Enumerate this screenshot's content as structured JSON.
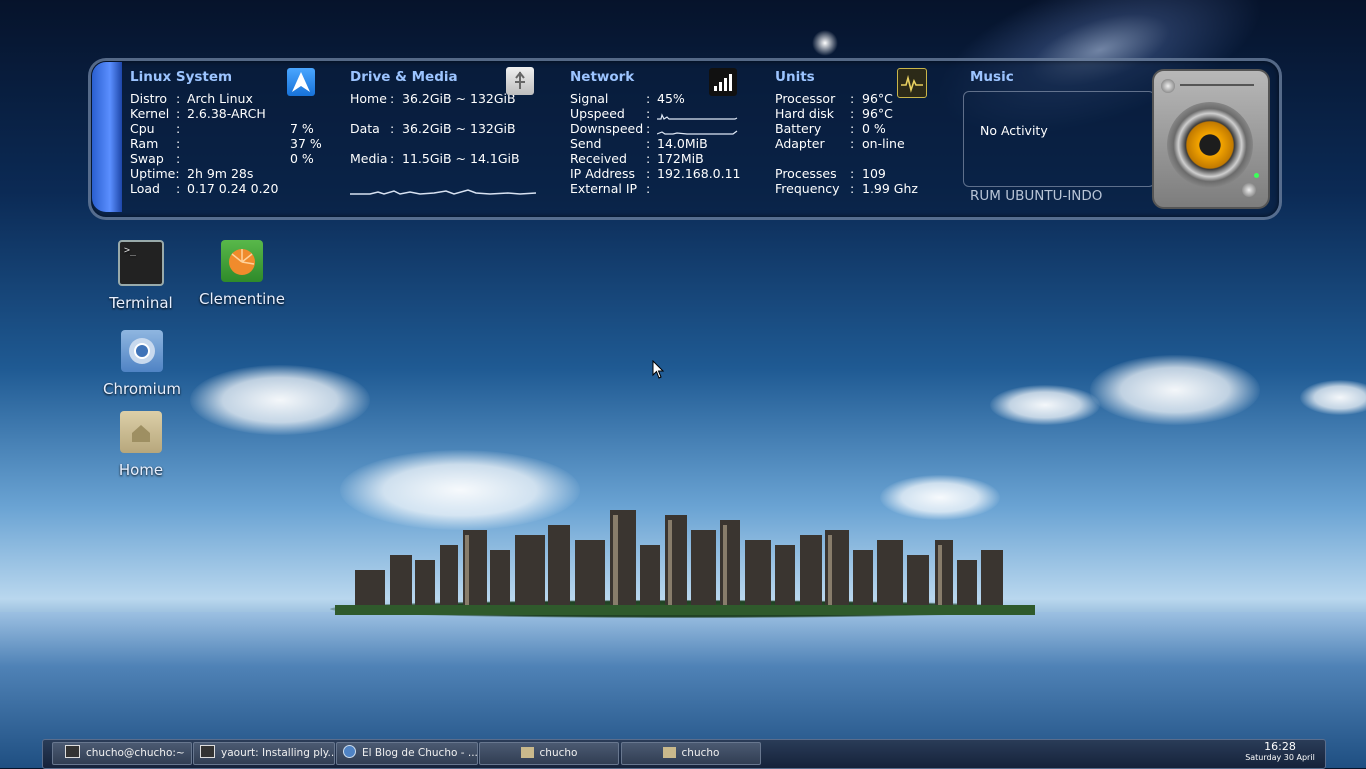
{
  "conky": {
    "linux": {
      "title": "Linux System",
      "rows": [
        {
          "k": "Distro",
          "v": "Arch Linux"
        },
        {
          "k": "Kernel",
          "v": "2.6.38-ARCH"
        },
        {
          "k": "Cpu",
          "v": "7 %"
        },
        {
          "k": "Ram",
          "v": "37 %"
        },
        {
          "k": "Swap",
          "v": "0 %"
        },
        {
          "k": "Uptime:",
          "v": "2h 9m 28s"
        },
        {
          "k": "Load",
          "v": "0.17 0.24 0.20"
        }
      ]
    },
    "drive": {
      "title": "Drive & Media",
      "rows": [
        {
          "k": "Home",
          "v": "36.2GiB ~ 132GiB"
        },
        {
          "k": "Data",
          "v": "36.2GiB ~ 132GiB"
        },
        {
          "k": "Media",
          "v": "11.5GiB ~ 14.1GiB"
        }
      ]
    },
    "network": {
      "title": "Network",
      "rows": [
        {
          "k": "Signal",
          "v": "45%"
        },
        {
          "k": "Upspeed",
          "v": ""
        },
        {
          "k": "Downspeed",
          "v": ""
        },
        {
          "k": "Send",
          "v": "14.0MiB"
        },
        {
          "k": "Received",
          "v": "172MiB"
        },
        {
          "k": "IP Address",
          "v": "192.168.0.11"
        },
        {
          "k": "External IP",
          "v": ""
        }
      ]
    },
    "units": {
      "title": "Units",
      "rows": [
        {
          "k": "Processor",
          "v": "96°C"
        },
        {
          "k": "Hard disk",
          "v": "96°C"
        },
        {
          "k": "Battery",
          "v": "0 %"
        },
        {
          "k": "Adapter",
          "v": "on-line"
        },
        {
          "k": "Processes",
          "v": "109"
        },
        {
          "k": "Frequency",
          "v": "1.99 Ghz"
        }
      ]
    },
    "music": {
      "title": "Music",
      "status": "No Activity",
      "footer": "RUM UBUNTU-INDO"
    },
    "separator": ":"
  },
  "desktop_icons": {
    "terminal": "Terminal",
    "clementine": "Clementine",
    "chromium": "Chromium",
    "home": "Home"
  },
  "taskbar": {
    "tasks": [
      "chucho@chucho:~",
      "yaourt: Installing ply...",
      "El Blog de Chucho - ...",
      "chucho",
      "chucho"
    ],
    "clock_time": "16:28",
    "clock_date": "Saturday 30 April"
  },
  "colors": {
    "section_title": "#9cc4ff",
    "panel_accent": "#3b6fe0"
  }
}
